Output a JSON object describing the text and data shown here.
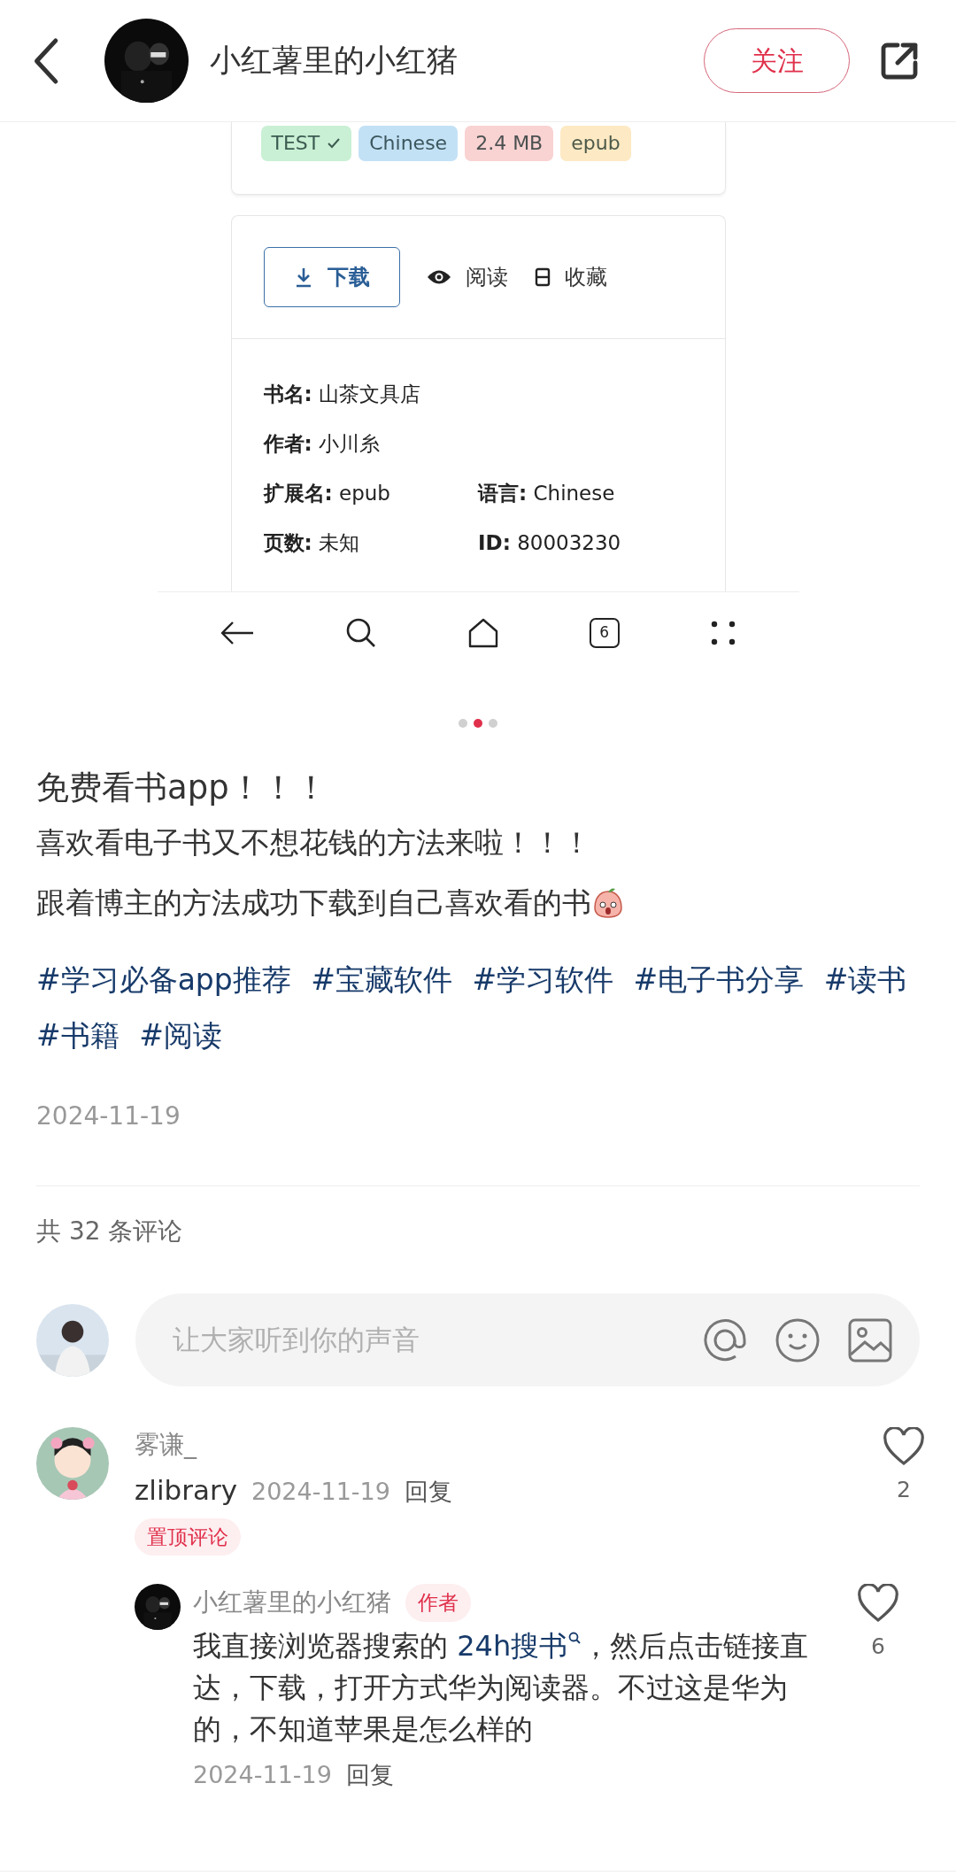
{
  "header": {
    "author": "小红薯里的小红猪",
    "follow": "关注"
  },
  "screenshot": {
    "tags": [
      {
        "label": "TEST",
        "verified": true,
        "color": "#c9f0d4"
      },
      {
        "label": "Chinese",
        "verified": false,
        "color": "#c3e1f5"
      },
      {
        "label": "2.4 MB",
        "verified": false,
        "color": "#f9d2d2"
      },
      {
        "label": "epub",
        "verified": false,
        "color": "#fde9c3"
      }
    ],
    "actions": [
      {
        "label": "下载",
        "kind": "download"
      },
      {
        "label": "阅读",
        "kind": "read"
      },
      {
        "label": "收藏",
        "kind": "bookmark"
      }
    ],
    "fields": [
      [
        {
          "key": "书名:",
          "value": "山茶文具店"
        }
      ],
      [
        {
          "key": "作者:",
          "value": "小川糸"
        }
      ],
      [
        {
          "key": "扩展名:",
          "value": "epub"
        },
        {
          "key": "语言:",
          "value": "Chinese"
        }
      ],
      [
        {
          "key": "页数:",
          "value": "未知"
        },
        {
          "key": "ID:",
          "value": "80003230"
        }
      ]
    ],
    "nav": {
      "tab_count": "6"
    }
  },
  "pager": [
    {
      "selected": false
    },
    {
      "selected": true
    },
    {
      "selected": false
    }
  ],
  "post": {
    "title": "免费看书app！！！",
    "lines": [
      {
        "text": "喜欢看电子书又不想花钱的方法来啦！！！",
        "trailing_emoji": false
      },
      {
        "text": "跟着博主的方法成功下载到自己喜欢看的书",
        "trailing_emoji": true
      }
    ],
    "hashtags": [
      "#学习必备app推荐",
      "#宝藏软件",
      "#学习软件",
      "#电子书分享",
      "#读书",
      "#书籍",
      "#阅读"
    ],
    "date": "2024-11-19"
  },
  "comments_count": "共 32 条评论",
  "comment_input": {
    "placeholder": "让大家听到你的声音"
  },
  "comments": [
    {
      "user": "雾谦_",
      "text": "zlibrary",
      "date": "2024-11-19",
      "reply": "回复",
      "badge": "置顶评论",
      "likes": "2",
      "liked": false,
      "replies": [
        {
          "user": "小红薯里的小红猪",
          "badge": "作者",
          "before": "我直接浏览器搜索的 ",
          "link": "24h搜书",
          "after": "，然后点击链接直达，下载，打开方式华为阅读器。不过这是华为的，不知道苹果是怎么样的",
          "date": "2024-11-19",
          "reply": "回复",
          "likes": "6",
          "liked": false
        }
      ]
    }
  ]
}
